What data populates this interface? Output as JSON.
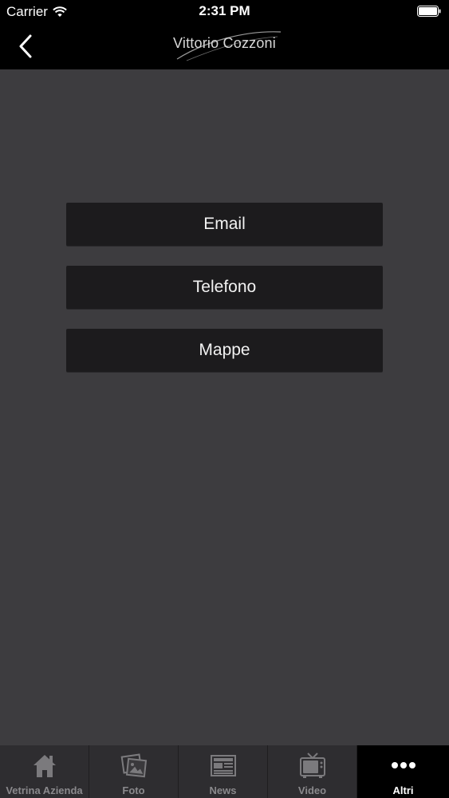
{
  "status_bar": {
    "carrier": "Carrier",
    "time": "2:31 PM",
    "wifi_icon": "wifi-icon",
    "battery_icon": "battery-icon"
  },
  "nav": {
    "back_icon": "chevron-left-icon",
    "brand": "Vittorio Cozzoni"
  },
  "buttons": {
    "email": "Email",
    "phone": "Telefono",
    "maps": "Mappe"
  },
  "tabs": [
    {
      "label": "Vetrina Azienda",
      "icon": "home-icon",
      "active": false
    },
    {
      "label": "Foto",
      "icon": "photos-icon",
      "active": false
    },
    {
      "label": "News",
      "icon": "newspaper-icon",
      "active": false
    },
    {
      "label": "Video",
      "icon": "tv-icon",
      "active": false
    },
    {
      "label": "Altri",
      "icon": "more-icon",
      "active": true
    }
  ],
  "colors": {
    "background": "#3d3c3f",
    "header": "#000000",
    "button": "#1c1b1d",
    "tab_bar": "#2e2d30",
    "tab_active": "#000000"
  }
}
